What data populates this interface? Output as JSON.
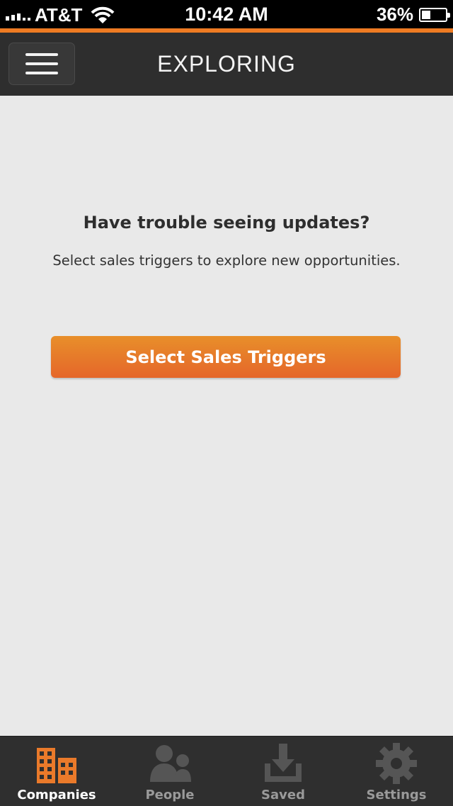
{
  "status_bar": {
    "carrier": "AT&T",
    "time": "10:42 AM",
    "battery": "36%",
    "battery_level": 0.36
  },
  "nav": {
    "title": "EXPLORING",
    "menu_icon": "hamburger-menu-icon"
  },
  "main": {
    "headline": "Have trouble seeing updates?",
    "subtext": "Select sales triggers to explore new opportunities.",
    "cta_label": "Select Sales Triggers"
  },
  "tabs": [
    {
      "label": "Companies",
      "icon": "buildings-icon",
      "active": true
    },
    {
      "label": "People",
      "icon": "people-icon",
      "active": false
    },
    {
      "label": "Saved",
      "icon": "download-tray-icon",
      "active": false
    },
    {
      "label": "Settings",
      "icon": "gear-icon",
      "active": false
    }
  ],
  "colors": {
    "accent": "#ee7b23",
    "button_top": "#e88f2a",
    "button_bottom": "#e5662a",
    "bar_bg": "#2e2e2e",
    "content_bg": "#e9e9e9"
  }
}
